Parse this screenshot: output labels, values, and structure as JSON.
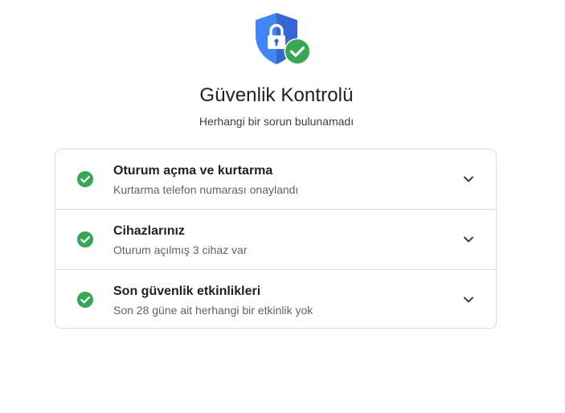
{
  "header": {
    "icon": "shield-lock-check-icon",
    "title": "Güvenlik Kontrolü",
    "subtitle": "Herhangi bir sorun bulunamadı"
  },
  "items": [
    {
      "title": "Oturum açma ve kurtarma",
      "description": "Kurtarma telefon numarası onaylandı",
      "status_icon": "check-circle-icon",
      "expand_icon": "chevron-down-icon"
    },
    {
      "title": "Cihazlarınız",
      "description": "Oturum açılmış 3 cihaz var",
      "status_icon": "check-circle-icon",
      "expand_icon": "chevron-down-icon"
    },
    {
      "title": "Son güvenlik etkinlikleri",
      "description": "Son 28 güne ait herhangi bir etkinlik yok",
      "status_icon": "check-circle-icon",
      "expand_icon": "chevron-down-icon"
    }
  ],
  "colors": {
    "shield_blue": "#4285f4",
    "shield_dark_blue": "#3367d6",
    "success_green": "#34a853",
    "border": "#dadce0"
  }
}
